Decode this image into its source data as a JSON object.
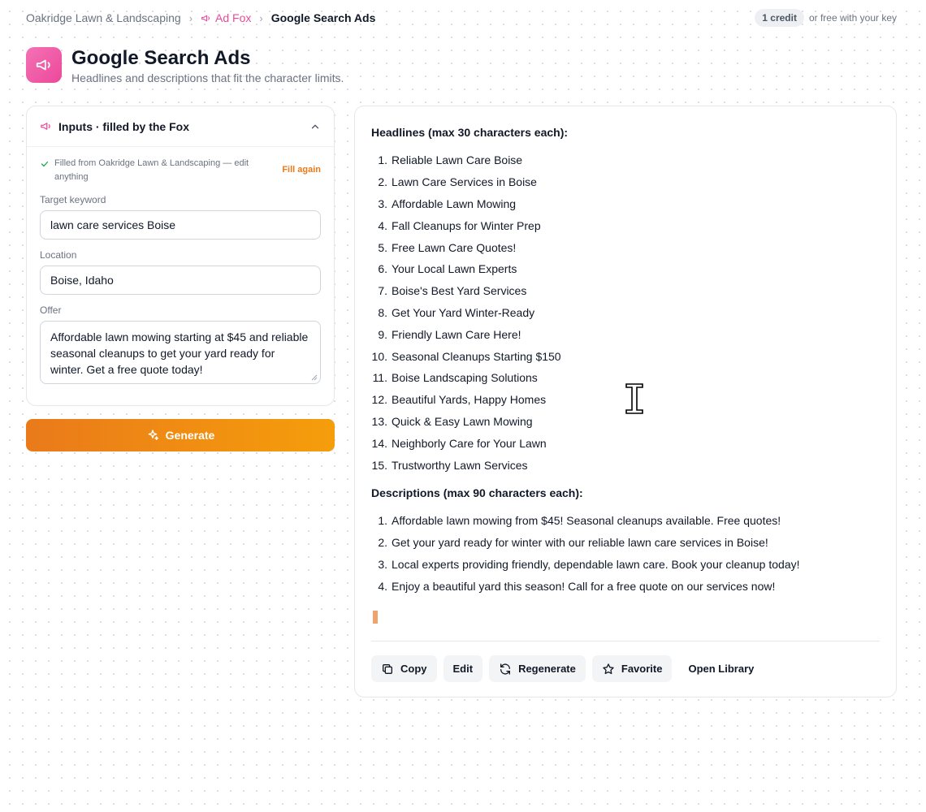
{
  "breadcrumb": {
    "business": "Oakridge Lawn & Landscaping",
    "tool": "Ad Fox",
    "current": "Google Search Ads"
  },
  "credits": {
    "pill": "1 credit",
    "note": "or free with your key"
  },
  "header": {
    "icon": "megaphone-icon",
    "title": "Google Search Ads",
    "subtitle": "Headlines and descriptions that fit the character limits."
  },
  "inputs_panel": {
    "title": "Inputs · filled by the Fox",
    "fill_note": "Filled from Oakridge Lawn & Landscaping — edit anything",
    "fill_again": "Fill again",
    "keyword_label": "Target keyword",
    "keyword_value": "lawn care services Boise",
    "location_label": "Location",
    "location_value": "Boise, Idaho",
    "offer_label": "Offer",
    "offer_value": "Affordable lawn mowing starting at $45 and reliable seasonal cleanups to get your yard ready for winter. Get a free quote today!"
  },
  "generate_label": "Generate",
  "output": {
    "headlines_title": "Headlines (max 30 characters each):",
    "headlines": [
      "Reliable Lawn Care Boise",
      "Lawn Care Services in Boise",
      "Affordable Lawn Mowing",
      "Fall Cleanups for Winter Prep",
      "Free Lawn Care Quotes!",
      "Your Local Lawn Experts",
      "Boise's Best Yard Services",
      "Get Your Yard Winter-Ready",
      "Friendly Lawn Care Here!",
      "Seasonal Cleanups Starting $150",
      "Boise Landscaping Solutions",
      "Beautiful Yards, Happy Homes",
      "Quick & Easy Lawn Mowing",
      "Neighborly Care for Your Lawn",
      "Trustworthy Lawn Services"
    ],
    "descriptions_title": "Descriptions (max 90 characters each):",
    "descriptions": [
      "Affordable lawn mowing from $45! Seasonal cleanups available. Free quotes!",
      "Get your yard ready for winter with our reliable lawn care services in Boise!",
      "Local experts providing friendly, dependable lawn care. Book your cleanup today!",
      "Enjoy a beautiful yard this season! Call for a free quote on our services now!"
    ]
  },
  "actions": {
    "copy": "Copy",
    "edit": "Edit",
    "regenerate": "Regenerate",
    "favorite": "Favorite",
    "open_library": "Open Library"
  },
  "colors": {
    "accent_pink": "#ec4899",
    "accent_orange": "#ea7a1a"
  }
}
